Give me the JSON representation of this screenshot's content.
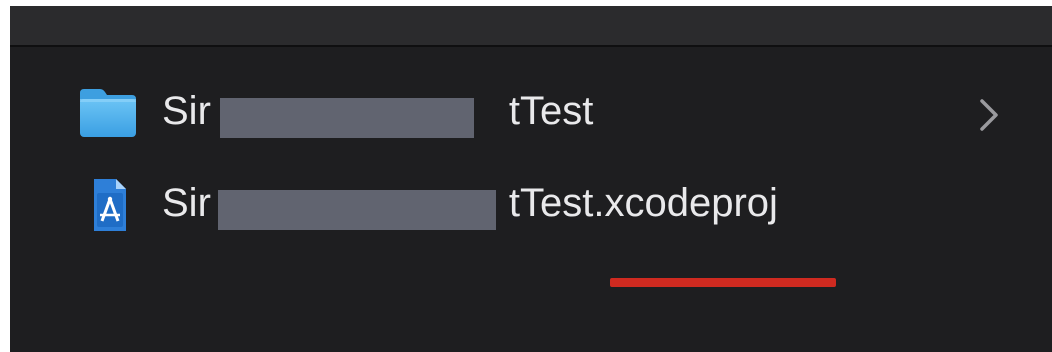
{
  "window": {
    "file_list": {
      "items": [
        {
          "kind": "folder",
          "icon": "folder-icon",
          "name_prefix": "Sir",
          "name_suffix": "tTest",
          "has_disclosure": true,
          "disclosure_icon": "chevron-right-icon"
        },
        {
          "kind": "xcode-project",
          "icon": "xcode-project-icon",
          "name_prefix": "Sir",
          "name_suffix": "tTest.xcodeproj"
        }
      ]
    }
  },
  "annotation": {
    "underline_color": "#cf2a20",
    "underlined_text": "xcodeproj"
  },
  "colors": {
    "window_background": "#1e1e20",
    "toolbar_background": "#2b2b2d",
    "text": "#e9e9eb",
    "redaction": "#616470",
    "folder_blue": "#53b3ef"
  }
}
